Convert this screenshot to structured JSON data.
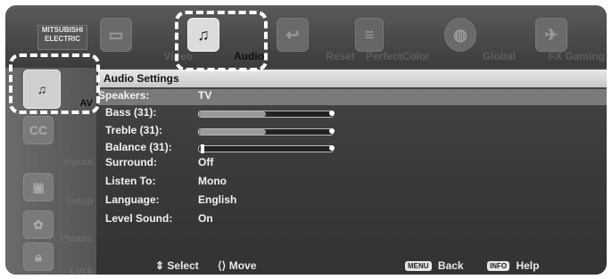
{
  "brand": {
    "line1": "MITSUBISHI",
    "line2": "ELECTRIC"
  },
  "top_menu": [
    {
      "label": "Video",
      "icon": "tv-icon"
    },
    {
      "label": "Audio",
      "icon": "speaker-icon",
      "active": true
    },
    {
      "label": "",
      "icon": "return-icon"
    },
    {
      "label": "Reset",
      "icon": "reset-icon"
    },
    {
      "label": "PerfectColor",
      "icon": "perfect-color-icon"
    },
    {
      "label": "Global",
      "icon": "globe-icon"
    },
    {
      "label": "FX Gaming",
      "icon": "gaming-icon"
    }
  ],
  "sidebar": [
    {
      "label": "AV",
      "icon": "speaker-icon",
      "active": true
    },
    {
      "label": "",
      "icon": "cc-icon"
    },
    {
      "label": "Inputs",
      "icon": "inputs-icon"
    },
    {
      "label": "Setup",
      "icon": "setup-icon"
    },
    {
      "label": "Photos",
      "icon": "photos-icon"
    },
    {
      "label": "Lock",
      "icon": "lock-icon"
    }
  ],
  "panel": {
    "title": "Audio Settings",
    "rows": [
      {
        "label": "Speakers:",
        "value": "TV"
      },
      {
        "label": "Bass (31):",
        "value": "",
        "slider": 0.5
      },
      {
        "label": "Treble (31):",
        "value": "",
        "slider": 0.5
      },
      {
        "label": "Balance (31):",
        "value": "",
        "slider": 0.02
      },
      {
        "label": "Surround:",
        "value": "Off"
      },
      {
        "label": "Listen To:",
        "value": "Mono"
      },
      {
        "label": "Language:",
        "value": "English"
      },
      {
        "label": "Level Sound:",
        "value": "On"
      }
    ]
  },
  "footer": {
    "select": "Select",
    "move": "Move",
    "back_key": "MENU",
    "back": "Back",
    "help_key": "INFO",
    "help": "Help"
  }
}
